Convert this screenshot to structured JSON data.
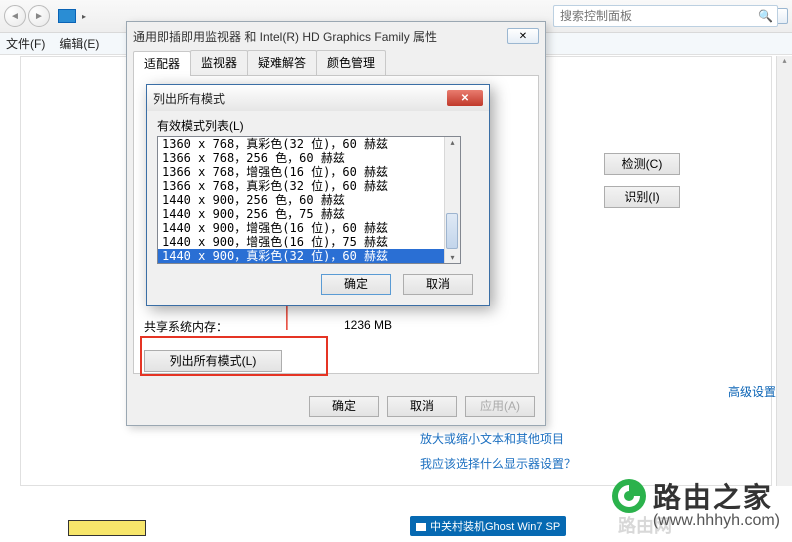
{
  "window": {
    "min": "—",
    "max": "☐",
    "close": "✕"
  },
  "search": {
    "placeholder": "搜索控制面板"
  },
  "menubar": {
    "file": "文件(F)",
    "edit": "编辑(E)"
  },
  "propDialog": {
    "title": "通用即插即用监视器 和 Intel(R) HD Graphics Family 属性",
    "tabs": {
      "adapter": "适配器",
      "monitor": "监视器",
      "troubleshoot": "疑难解答",
      "color": "颜色管理"
    },
    "sharedMemLabel": "共享系统内存：",
    "sharedMemValue": "1236 MB",
    "listAllBtn": "列出所有模式(L)",
    "ok": "确定",
    "cancel": "取消",
    "apply": "应用(A)"
  },
  "modal": {
    "title": "列出所有模式",
    "listLabel": "有效模式列表(L)",
    "rows": [
      "1360 x 768，真彩色(32 位)，60 赫兹",
      "1366 x 768，256 色，60 赫兹",
      "1366 x 768，增强色(16 位)，60 赫兹",
      "1366 x 768，真彩色(32 位)，60 赫兹",
      "1440 x 900，256 色，60 赫兹",
      "1440 x 900，256 色，75 赫兹",
      "1440 x 900，增强色(16 位)，60 赫兹",
      "1440 x 900，增强色(16 位)，75 赫兹",
      "1440 x 900，真彩色(32 位)，60 赫兹"
    ],
    "selectedIndex": 8,
    "ok": "确定",
    "cancel": "取消"
  },
  "rightButtons": {
    "detect": "检测(C)",
    "identify": "识别(I)"
  },
  "advLink": "高级设置",
  "help": {
    "zoom": "放大或缩小文本和其他项目",
    "which": "我应该选择什么显示器设置？"
  },
  "ghost": "中关村装机Ghost Win7 SP",
  "wm": {
    "brand": "路由之家",
    "url": "(www.hhhyh.com)"
  },
  "faint": "路由网"
}
